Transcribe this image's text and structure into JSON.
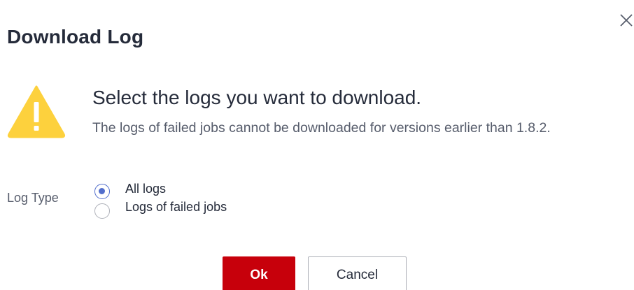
{
  "dialog": {
    "title": "Download Log",
    "close_icon": "close-icon"
  },
  "message": {
    "icon": "warning-triangle-icon",
    "headline": "Select the logs you want to download.",
    "description": "The logs of failed jobs cannot be downloaded for versions earlier than 1.8.2."
  },
  "log_type": {
    "label": "Log Type",
    "options": [
      {
        "label": "All logs",
        "selected": true
      },
      {
        "label": "Logs of failed jobs",
        "selected": false
      }
    ]
  },
  "buttons": {
    "ok_label": "Ok",
    "cancel_label": "Cancel"
  },
  "colors": {
    "primary_button": "#c7000b",
    "radio_accent": "#526ecc",
    "warning": "#fdd13d"
  }
}
